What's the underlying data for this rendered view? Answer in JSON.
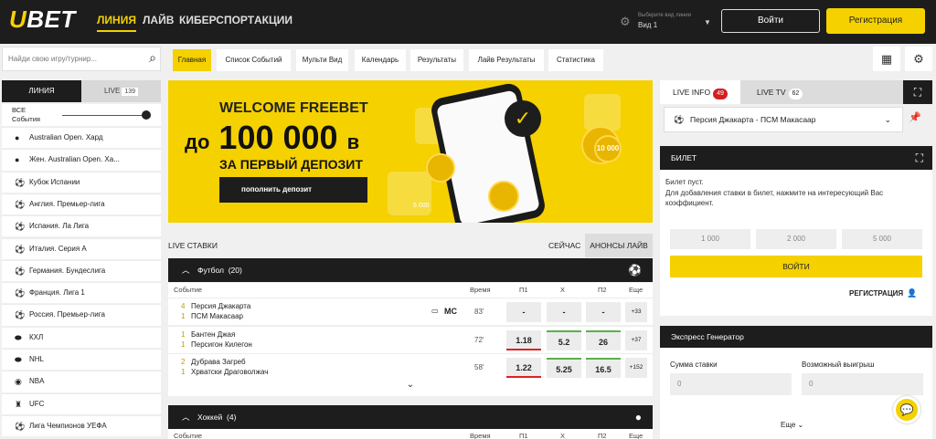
{
  "header": {
    "logo": "UBET",
    "nav": [
      "ЛИНИЯ",
      "ЛАЙВ",
      "КИБЕРСПОРТ",
      "АКЦИИ"
    ],
    "view_hint": "Выберите вид линии",
    "view_value": "Вид 1",
    "login": "Войти",
    "register": "Регистрация"
  },
  "toolbar": {
    "search_placeholder": "Найди свою игру/турнир...",
    "tabs": [
      "Главная",
      "Список Событий",
      "Мульти Вид",
      "Календарь",
      "Результаты",
      "Лайв Результаты",
      "Статистика"
    ]
  },
  "sidebar": {
    "tab_line": "ЛИНИЯ",
    "tab_live": "LIVE",
    "tab_live_count": "139",
    "all_events_1": "ВСЕ",
    "all_events_2": "События",
    "items": [
      {
        "label": "Australian Open. Хард",
        "icon": "tennis-icon"
      },
      {
        "label": "Жен. Australian Open. Ха...",
        "icon": "tennis-icon"
      },
      {
        "label": "Кубок Испании",
        "icon": "soccer-icon"
      },
      {
        "label": "Англия. Премьер-лига",
        "icon": "soccer-icon"
      },
      {
        "label": "Испания. Ла Лига",
        "icon": "soccer-icon"
      },
      {
        "label": "Италия. Серия А",
        "icon": "soccer-icon"
      },
      {
        "label": "Германия. Бундеслига",
        "icon": "soccer-icon"
      },
      {
        "label": "Франция. Лига 1",
        "icon": "soccer-icon"
      },
      {
        "label": "Россия. Премьер-лига",
        "icon": "soccer-icon"
      },
      {
        "label": "КХЛ",
        "icon": "hockey-icon"
      },
      {
        "label": "NHL",
        "icon": "hockey-icon"
      },
      {
        "label": "NBA",
        "icon": "basketball-icon"
      },
      {
        "label": "UFC",
        "icon": "mma-icon"
      },
      {
        "label": "Лига Чемпионов УЕФА",
        "icon": "soccer-icon"
      }
    ]
  },
  "banner": {
    "line1": "WELCOME FREEBET",
    "line2a": "до",
    "line2b": "100 000",
    "line2c": "в",
    "line3": "ЗА ПЕРВЫЙ ДЕПОЗИТ",
    "button": "пополнить депозит",
    "coin1": "10 000",
    "coin2": "5 000"
  },
  "live": {
    "title": "LIVE СТАВКИ",
    "now": "СЕЙЧАС",
    "announce": "АНОНСЫ ЛАЙВ",
    "football": {
      "label": "Футбол",
      "count": "(20)"
    },
    "hockey": {
      "label": "Хоккей",
      "count": "(4)"
    },
    "columns": {
      "event": "Событие",
      "time": "Время",
      "p1": "П1",
      "x": "X",
      "p2": "П2",
      "more": "Еще"
    },
    "events": [
      {
        "s1": "4",
        "t1": "Персия Джакарта",
        "s2": "1",
        "t2": "ПСМ Макасаар",
        "time": "83'",
        "p1": "-",
        "x": "-",
        "p2": "-",
        "more": "+33",
        "mc": "MC"
      },
      {
        "s1": "1",
        "t1": "Бантен Джая",
        "s2": "1",
        "t2": "Персигон Килегон",
        "time": "72'",
        "p1": "1.18",
        "x": "5.2",
        "p2": "26",
        "more": "+37"
      },
      {
        "s1": "2",
        "t1": "Дубрава Загреб",
        "s2": "1",
        "t2": "Хрватски Драговолжач",
        "time": "58'",
        "p1": "1.22",
        "x": "5.25",
        "p2": "16.5",
        "more": "+152"
      }
    ]
  },
  "right": {
    "live_info": "LIVE INFO",
    "live_info_count": "49",
    "live_tv": "LIVE TV",
    "live_tv_count": "62",
    "match": "Персия Джакарта - ПСМ Макасаар",
    "bilet_title": "БИЛЕТ",
    "bilet_empty": "Билет пуст.",
    "bilet_hint": "Для добавления ставки в билет, нажмите на интересующий Вас коэффициент.",
    "amounts": [
      "1 000",
      "2 000",
      "5 000"
    ],
    "vojti": "ВОЙТИ",
    "registration": "РЕГИСТРАЦИЯ",
    "express_title": "Экспресс Генератор",
    "stake_label": "Сумма ставки",
    "win_label": "Возможный выигрыш",
    "stake_value": "0",
    "win_value": "0",
    "more": "Еще"
  },
  "colors": {
    "accent": "#f5d100",
    "dark": "#1d1d1d",
    "live_badge": "#d21f1f"
  }
}
